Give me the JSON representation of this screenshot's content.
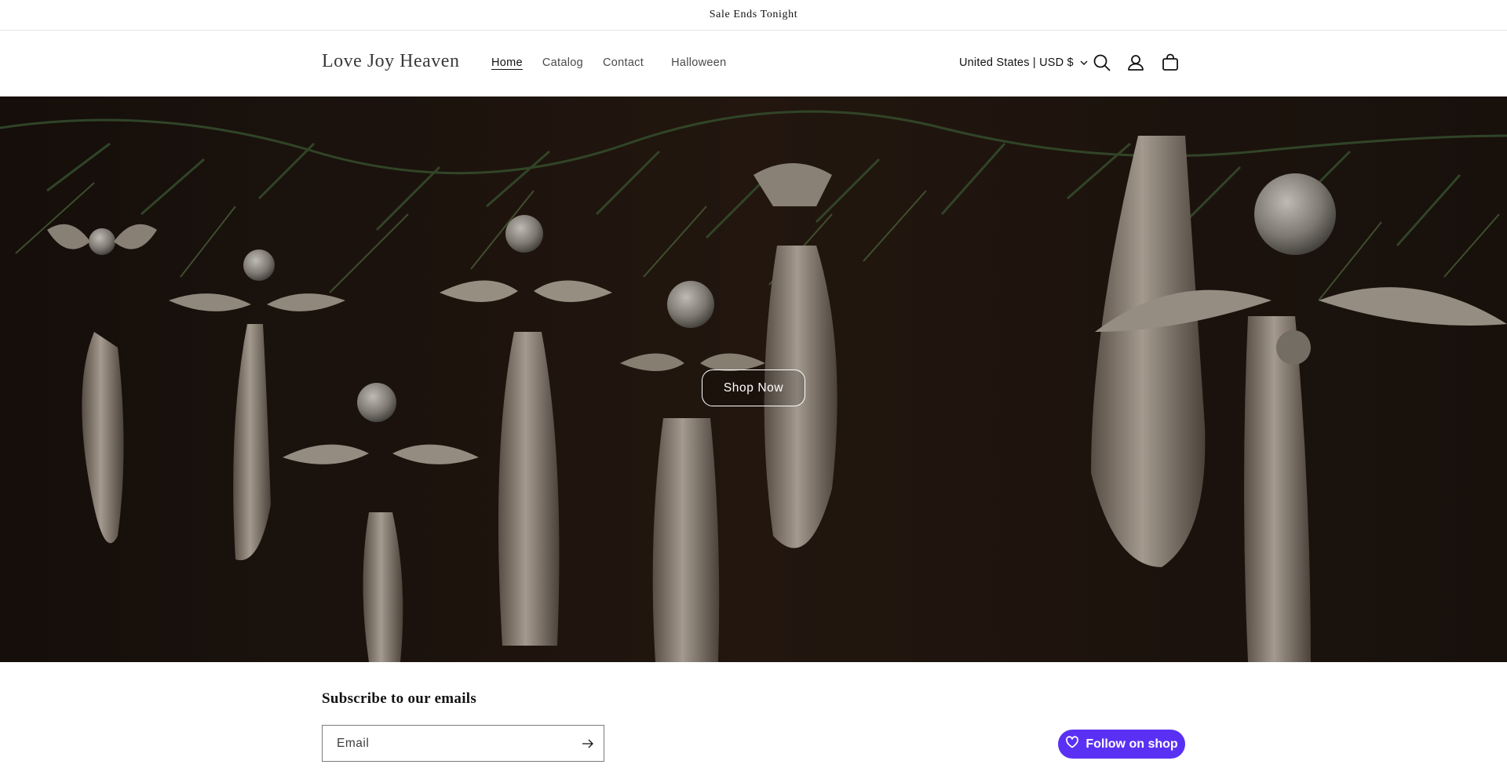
{
  "announcement": {
    "text": "Sale Ends Tonight"
  },
  "header": {
    "logo": "Love Joy Heaven",
    "nav": [
      {
        "label": "Home",
        "active": true
      },
      {
        "label": "Catalog",
        "active": false
      },
      {
        "label": "Contact",
        "active": false
      },
      {
        "label": "Halloween",
        "active": false
      }
    ],
    "localization": "United States | USD $",
    "icons": [
      "search-icon",
      "account-icon",
      "cart-icon"
    ]
  },
  "hero": {
    "button_label": "Shop Now",
    "image_description_icon": "angel-ornaments-image"
  },
  "newsletter": {
    "title": "Subscribe to our emails",
    "email_placeholder": "Email"
  },
  "follow": {
    "label": "Follow on shop",
    "color": "#5a31f4"
  },
  "colors": {
    "accent": "#5a31f4",
    "text": "#121212",
    "hero_bg": "#1b1411"
  }
}
